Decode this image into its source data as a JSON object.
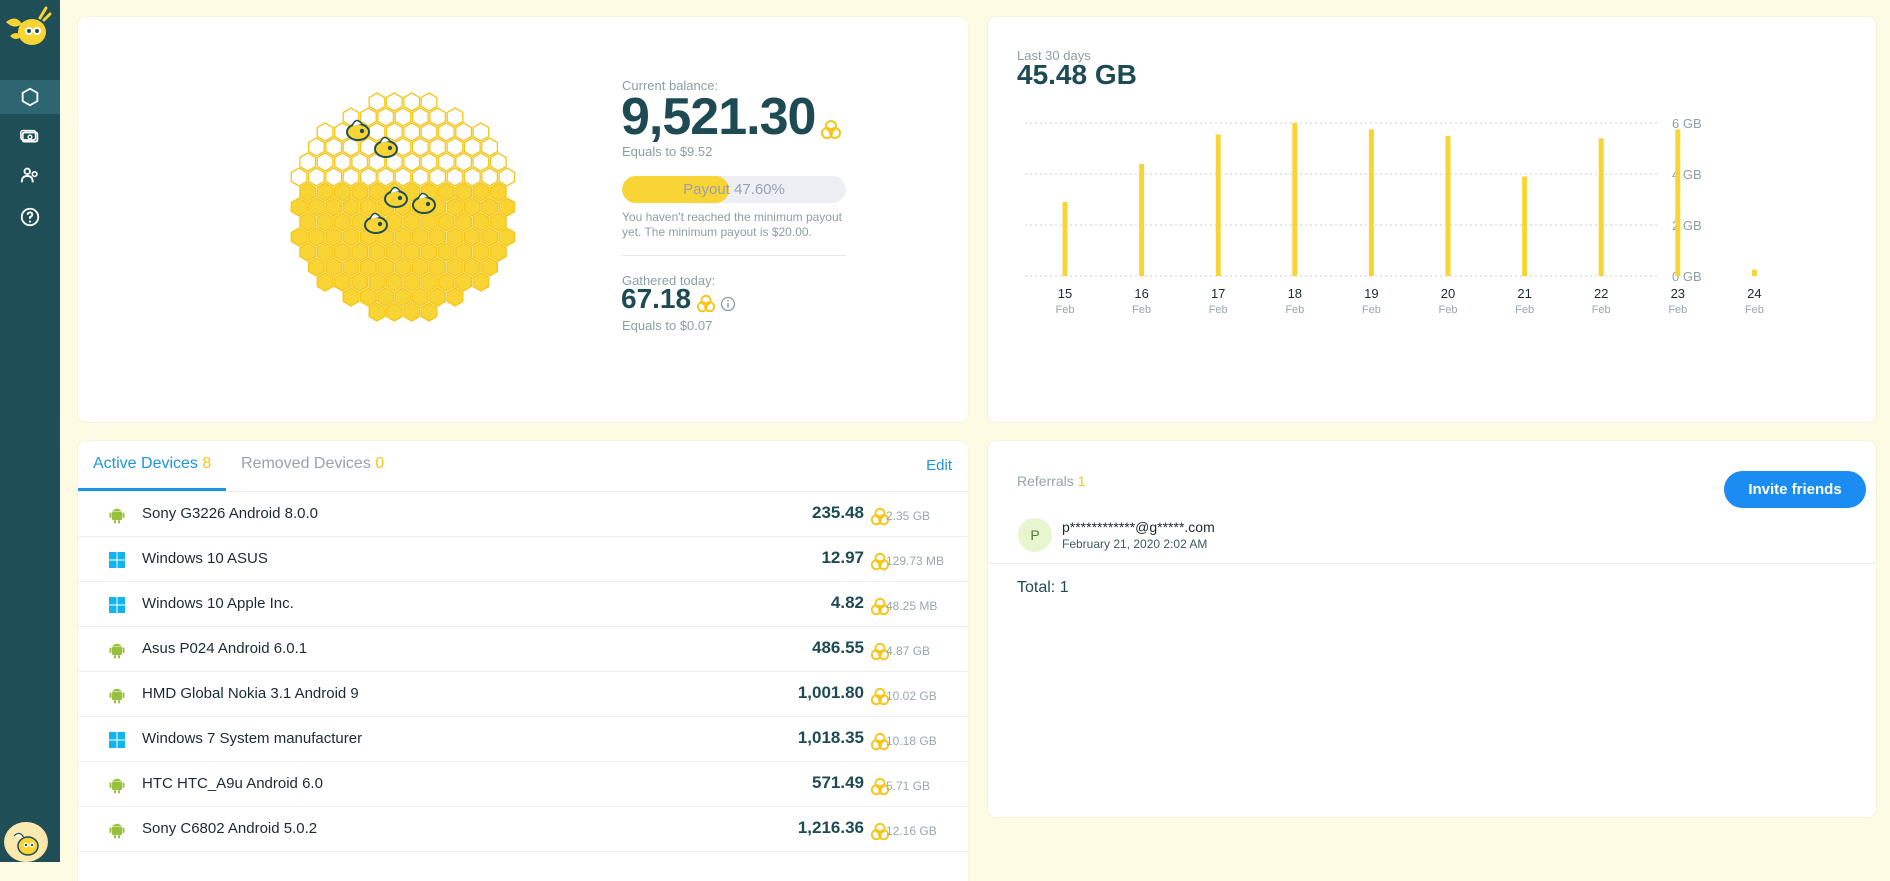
{
  "sidebar": {
    "nav": [
      {
        "name": "dashboard",
        "icon": "hexagon-icon"
      },
      {
        "name": "payments",
        "icon": "money-icon"
      },
      {
        "name": "referrals",
        "icon": "people-icon"
      },
      {
        "name": "help",
        "icon": "help-icon"
      }
    ]
  },
  "balance": {
    "current_label": "Current balance:",
    "current_value": "9,521.30",
    "current_usd": "Equals to $9.52",
    "payout_label": "Payout 47.60%",
    "payout_progress": 0.476,
    "payout_note": "You haven't reached the minimum payout yet. The minimum payout is $20.00.",
    "today_label": "Gathered today:",
    "today_value": "67.18",
    "today_usd": "Equals to $0.07"
  },
  "traffic": {
    "period_label": "Last 30 days",
    "total": "45.48 GB"
  },
  "chart_data": {
    "type": "bar",
    "categories": [
      "15 Feb",
      "16 Feb",
      "17 Feb",
      "18 Feb",
      "19 Feb",
      "20 Feb",
      "21 Feb",
      "22 Feb",
      "23 Feb",
      "24 Feb"
    ],
    "day_labels": [
      "15",
      "16",
      "17",
      "18",
      "19",
      "20",
      "21",
      "22",
      "23",
      "24"
    ],
    "month_labels": [
      "Feb",
      "Feb",
      "Feb",
      "Feb",
      "Feb",
      "Feb",
      "Feb",
      "Feb",
      "Feb",
      "Feb"
    ],
    "values": [
      2.9,
      4.4,
      5.55,
      6.0,
      5.75,
      5.5,
      3.9,
      5.4,
      5.75,
      0.25
    ],
    "yticks": [
      "6 GB",
      "4 GB",
      "2 GB",
      "0 GB"
    ],
    "ytick_values": [
      6,
      4,
      2,
      0
    ],
    "ylim": [
      0,
      6
    ],
    "ylabel_unit": "GB",
    "bar_color": "#f8d534",
    "grid": true
  },
  "devices": {
    "tab_active_label": "Active Devices",
    "tab_active_count": "8",
    "tab_removed_label": "Removed Devices",
    "tab_removed_count": "0",
    "edit_label": "Edit",
    "rows": [
      {
        "os": "android",
        "name": "Sony G3226 Android 8.0.0",
        "value": "235.48",
        "size": "2.35 GB"
      },
      {
        "os": "windows",
        "name": "Windows 10 ASUS",
        "value": "12.97",
        "size": "129.73 MB"
      },
      {
        "os": "windows",
        "name": "Windows 10 Apple Inc.",
        "value": "4.82",
        "size": "48.25 MB"
      },
      {
        "os": "android",
        "name": "Asus P024 Android 6.0.1",
        "value": "486.55",
        "size": "4.87 GB"
      },
      {
        "os": "android",
        "name": "HMD Global Nokia 3.1 Android 9",
        "value": "1,001.80",
        "size": "10.02 GB"
      },
      {
        "os": "windows",
        "name": "Windows 7 System manufacturer",
        "value": "1,018.35",
        "size": "10.18 GB"
      },
      {
        "os": "android",
        "name": "HTC HTC_A9u Android 6.0",
        "value": "571.49",
        "size": "5.71 GB"
      },
      {
        "os": "android",
        "name": "Sony C6802 Android 5.0.2",
        "value": "1,216.36",
        "size": "12.16 GB"
      }
    ]
  },
  "referrals": {
    "label": "Referrals",
    "count": "1",
    "invite_label": "Invite friends",
    "items": [
      {
        "initial": "P",
        "email": "p************@g*****.com",
        "date": "February 21, 2020 2:02 AM"
      }
    ],
    "total_label": "Total:",
    "total_value": "1"
  },
  "colors": {
    "sidebar": "#1f4e57",
    "accent_blue": "#1b95e0",
    "honey": "#f8d534",
    "text_dark": "#1e4b53",
    "android_green": "#97c03d",
    "windows_blue": "#10b4ef"
  }
}
